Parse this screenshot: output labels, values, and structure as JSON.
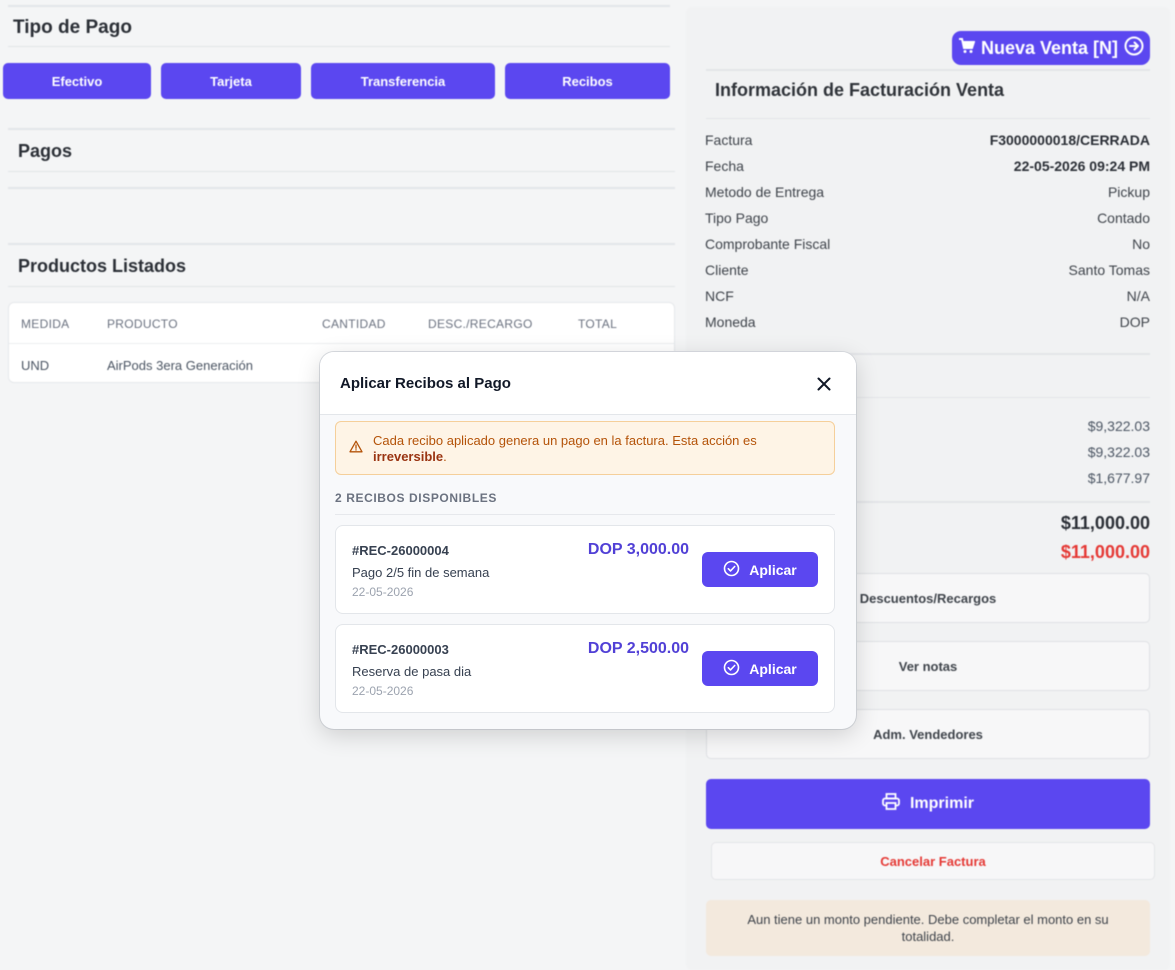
{
  "payment_type": {
    "title": "Tipo de Pago",
    "buttons": [
      "Efectivo",
      "Tarjeta",
      "Transferencia",
      "Recibos"
    ]
  },
  "payments": {
    "title": "Pagos"
  },
  "products": {
    "title": "Productos Listados",
    "columns": [
      "MEDIDA",
      "PRODUCTO",
      "CANTIDAD",
      "DESC./RECARGO",
      "TOTAL"
    ],
    "rows": [
      {
        "medida": "UND",
        "producto": "AirPods 3era Generación"
      }
    ]
  },
  "sidebar": {
    "new_sale_label": "Nueva Venta [N]",
    "info_title": "Información de Facturación Venta",
    "fields": [
      {
        "label": "Factura",
        "value": "F3000000018/CERRADA"
      },
      {
        "label": "Fecha",
        "value": "22-05-2026 09:24 PM"
      },
      {
        "label": "Metodo de Entrega",
        "value": "Pickup"
      },
      {
        "label": "Tipo Pago",
        "value": "Contado"
      },
      {
        "label": "Comprobante Fiscal",
        "value": "No"
      },
      {
        "label": "Cliente",
        "value": "Santo Tomas"
      },
      {
        "label": "NCF",
        "value": "N/A"
      },
      {
        "label": "Moneda",
        "value": "DOP"
      }
    ],
    "amounts": [
      "$9,322.03",
      "$9,322.03",
      "$1,677.97"
    ],
    "total": "$11,000.00",
    "pending_total": "$11,000.00",
    "discounts_label": "Descuentos/Recargos",
    "notes_label": "Ver notas",
    "sellers_label": "Adm. Vendedores",
    "print_label": "Imprimir",
    "cancel_label": "Cancelar Factura",
    "pending_message": "Aun tiene un monto pendiente. Debe completar el monto en su totalidad."
  },
  "modal": {
    "title": "Aplicar Recibos al Pago",
    "warning_text": "Cada recibo aplicado genera un pago en la factura. Esta acción es ",
    "warning_bold": "irreversible",
    "warning_end": ".",
    "count_label": "2 RECIBOS DISPONIBLES",
    "apply_label": "Aplicar",
    "receipts": [
      {
        "number": "#REC-26000004",
        "description": "Pago 2/5 fin de semana",
        "date": "22-05-2026",
        "amount": "DOP 3,000.00"
      },
      {
        "number": "#REC-26000003",
        "description": "Reserva de pasa dia",
        "date": "22-05-2026",
        "amount": "DOP 2,500.00"
      }
    ]
  },
  "colors": {
    "accent": "#5b47f0",
    "danger": "#e53935",
    "warning_text": "#b45309"
  }
}
